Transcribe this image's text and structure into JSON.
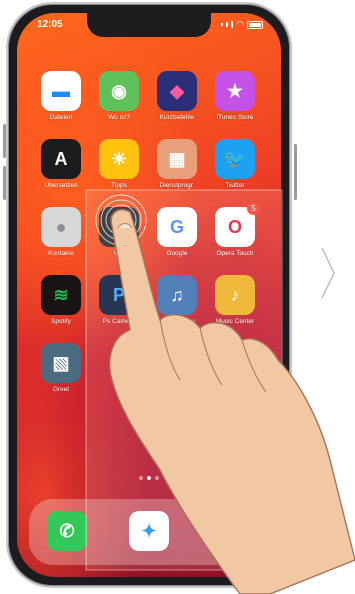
{
  "status_bar": {
    "time": "12:05"
  },
  "apps": [
    {
      "label": "Dateien",
      "icon": "files-folder-icon",
      "bg": "#ffffff",
      "fg": "#1a8cff"
    },
    {
      "label": "Wo ist?",
      "icon": "find-my-icon",
      "bg": "#5fc15a",
      "fg": "#ffffff"
    },
    {
      "label": "Kurzbefehle",
      "icon": "shortcuts-icon",
      "bg": "#2b2f7a",
      "fg": "#ff5aa0"
    },
    {
      "label": "iTunes Store",
      "icon": "star-icon",
      "bg": "#c651e8",
      "fg": "#ffffff"
    },
    {
      "label": "Übersetzen",
      "icon": "translate-icon",
      "bg": "#1c1c1e",
      "fg": "#ffffff"
    },
    {
      "label": "Tipps",
      "icon": "lightbulb-icon",
      "bg": "#ffc20e",
      "fg": "#ffffff"
    },
    {
      "label": "Dienstprogr.",
      "icon": "folder-grid-icon",
      "bg": "#e8a07a",
      "fg": "#ffffff"
    },
    {
      "label": "Twitter",
      "icon": "twitter-bird-icon",
      "bg": "#1da1f2",
      "fg": "#ffffff"
    },
    {
      "label": "Kontakte",
      "icon": "contacts-icon",
      "bg": "#d8d8d8",
      "fg": "#8e8e93"
    },
    {
      "label": "Vito",
      "icon": "vito-icon",
      "bg": "#2a2a2a",
      "fg": "#ffffff"
    },
    {
      "label": "Google",
      "icon": "google-icon",
      "bg": "#ffffff",
      "fg": "#4285f4"
    },
    {
      "label": "Opera Touch",
      "icon": "opera-icon",
      "bg": "#ffffff",
      "fg": "#e8183a",
      "badge": "5"
    },
    {
      "label": "Spotify",
      "icon": "spotify-icon",
      "bg": "#191414",
      "fg": "#1db954"
    },
    {
      "label": "Ps Camera",
      "icon": "ps-camera-icon",
      "bg": "#0b1a3c",
      "fg": "#31a8ff"
    },
    {
      "label": "SharkLibrary",
      "icon": "sharkLibrary-icon",
      "bg": "#3a6fb0",
      "fg": "#ffffff"
    },
    {
      "label": "Music Center",
      "icon": "music-note-icon",
      "bg": "#f0b020",
      "fg": "#ffffff"
    },
    {
      "label": "Greet",
      "icon": "greet-photo-icon",
      "bg": "#4a6b80",
      "fg": "#ffffff"
    }
  ],
  "glyphs": {
    "files-folder-icon": "▬",
    "find-my-icon": "◉",
    "shortcuts-icon": "◆",
    "star-icon": "★",
    "translate-icon": "A",
    "lightbulb-icon": "☀",
    "folder-grid-icon": "▦",
    "twitter-bird-icon": "🐦",
    "contacts-icon": "●",
    "vito-icon": "✕",
    "google-icon": "G",
    "opera-icon": "O",
    "spotify-icon": "≋",
    "ps-camera-icon": "P",
    "sharkLibrary-icon": "♫",
    "music-note-icon": "♪",
    "greet-photo-icon": "▧"
  },
  "dock": [
    {
      "icon": "phone-icon",
      "bg": "#34c759",
      "glyph": "✆"
    },
    {
      "icon": "safari-compass-icon",
      "bg": "#ffffff",
      "glyph": "✦"
    },
    {
      "icon": "messages-icon",
      "bg": "#34c759",
      "glyph": "💬"
    }
  ],
  "page_dots": 3,
  "active_dot": 1
}
